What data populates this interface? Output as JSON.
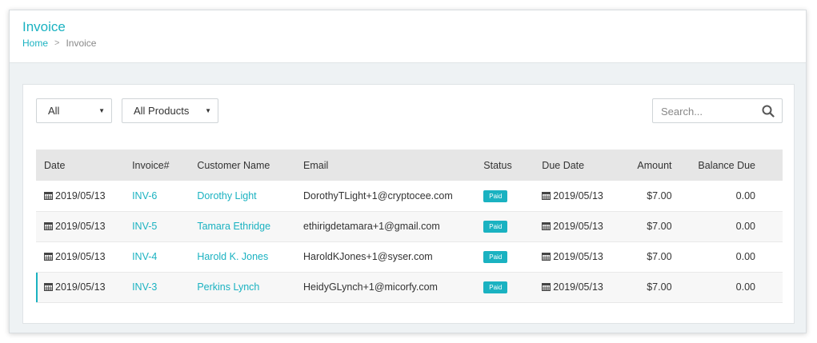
{
  "page": {
    "title": "Invoice",
    "breadcrumb": {
      "home": "Home",
      "separator": ">",
      "current": "Invoice"
    }
  },
  "filters": {
    "status_select": {
      "value": "All"
    },
    "product_select": {
      "value": "All Products"
    },
    "search": {
      "placeholder": "Search..."
    }
  },
  "table": {
    "headers": {
      "date": "Date",
      "invoice": "Invoice#",
      "customer": "Customer Name",
      "email": "Email",
      "status": "Status",
      "due_date": "Due Date",
      "amount": "Amount",
      "balance": "Balance Due"
    },
    "rows": [
      {
        "date": "2019/05/13",
        "invoice": "INV-6",
        "customer": "Dorothy Light",
        "email": "DorothyTLight+1@cryptocee.com",
        "status": "Paid",
        "due_date": "2019/05/13",
        "amount": "$7.00",
        "balance": "0.00"
      },
      {
        "date": "2019/05/13",
        "invoice": "INV-5",
        "customer": "Tamara Ethridge",
        "email": "ethirigdetamara+1@gmail.com",
        "status": "Paid",
        "due_date": "2019/05/13",
        "amount": "$7.00",
        "balance": "0.00"
      },
      {
        "date": "2019/05/13",
        "invoice": "INV-4",
        "customer": "Harold K. Jones",
        "email": "HaroldKJones+1@syser.com",
        "status": "Paid",
        "due_date": "2019/05/13",
        "amount": "$7.00",
        "balance": "0.00"
      },
      {
        "date": "2019/05/13",
        "invoice": "INV-3",
        "customer": "Perkins Lynch",
        "email": "HeidyGLynch+1@micorfy.com",
        "status": "Paid",
        "due_date": "2019/05/13",
        "amount": "$7.00",
        "balance": "0.00"
      }
    ]
  },
  "icons": {
    "calendar": "calendar-icon",
    "search": "search-icon",
    "caret": "caret-down-icon",
    "chevron": "chevron-right-icon"
  },
  "colors": {
    "accent": "#1ab2c1",
    "header_row": "#e6e6e6",
    "background": "#eef2f4"
  }
}
